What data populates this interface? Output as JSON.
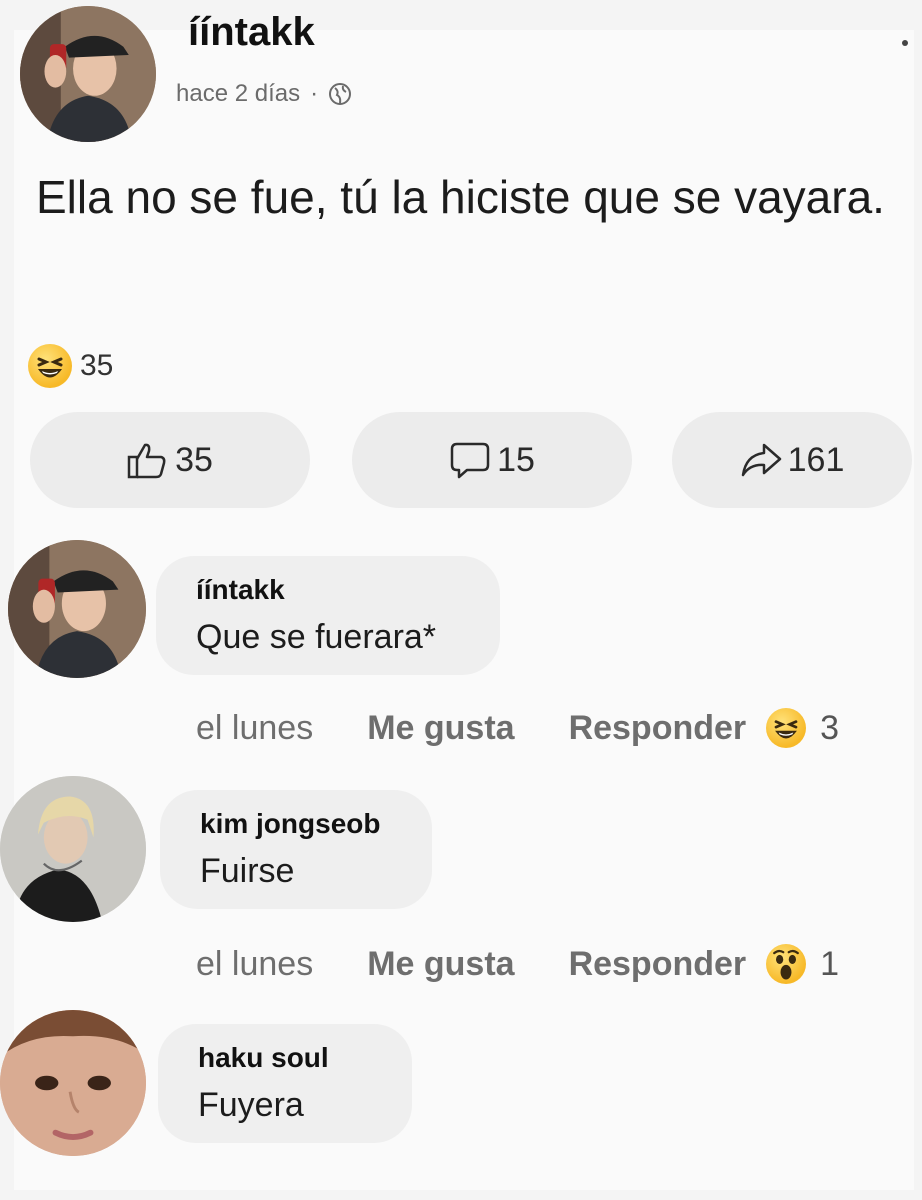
{
  "post": {
    "author": "ííntakk",
    "time": "hace 2 días",
    "dot": "·",
    "text": "Ella no se fue, tú la hiciste que se vayara.",
    "reaction_count": "35"
  },
  "actions": {
    "like_count": "35",
    "comment_count": "15",
    "share_count": "161"
  },
  "comments": [
    {
      "author": "ííntakk",
      "text": "Que se fuerara*",
      "time": "el lunes",
      "like": "Me gusta",
      "reply": "Responder",
      "reaction": "laugh",
      "reaction_count": "3"
    },
    {
      "author": "kim jongseob",
      "text": "Fuirse",
      "time": "el lunes",
      "like": "Me gusta",
      "reply": "Responder",
      "reaction": "wow",
      "reaction_count": "1"
    },
    {
      "author": "haku soul",
      "text": "Fuyera"
    }
  ],
  "colors": {
    "reaction_yellow": "#f7b928",
    "bubble": "#efefef",
    "muted_text": "#6e6e6e"
  }
}
